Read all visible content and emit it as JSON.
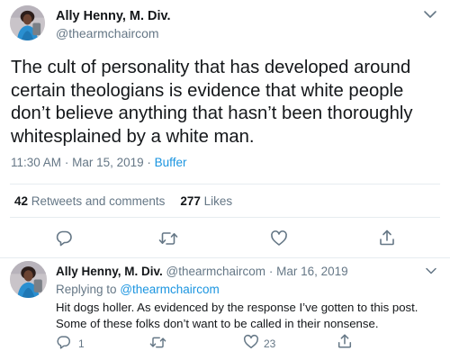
{
  "tweet": {
    "author_name": "Ally Henny, M. Div.",
    "author_handle": "@thearmchaircom",
    "text": "The cult of personality that has developed around certain theologians is evidence that white people don’t believe anything that hasn’t been thoroughly whitesplained by a white man.",
    "time": "11:30 AM",
    "separator": "·",
    "date": "Mar 15, 2019",
    "source": "Buffer",
    "retweets_count": "42",
    "retweets_label": "Retweets and comments",
    "likes_count": "277",
    "likes_label": "Likes",
    "icons": [
      "reply-icon",
      "retweet-icon",
      "like-icon",
      "share-icon",
      "caret-down-icon"
    ]
  },
  "reply": {
    "author_name": "Ally Henny, M. Div.",
    "author_handle": "@thearmchaircom",
    "separator": "·",
    "date": "Mar 16, 2019",
    "replying_to_label": "Replying to",
    "replying_to_handle": "@thearmchaircom",
    "text": "Hit dogs holler. As evidenced by the response I’ve gotten to this post. Some of these folks don’t want to be called in their nonsense.",
    "reply_count": "1",
    "like_count": "23"
  },
  "colors": {
    "text_primary": "#14171a",
    "text_secondary": "#657786",
    "link": "#1b95e0",
    "divider": "#e6ecf0",
    "icon": "#657786"
  }
}
